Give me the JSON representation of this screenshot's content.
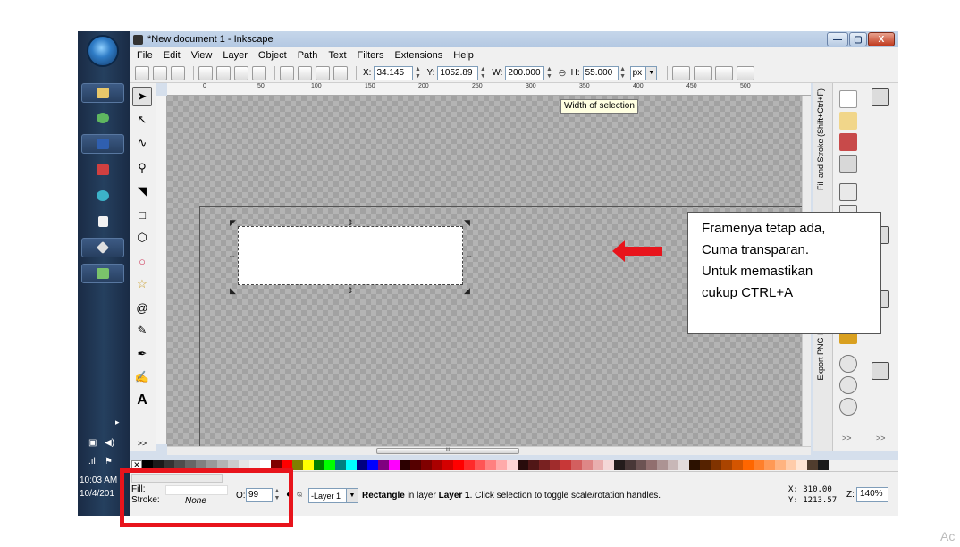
{
  "taskbar": {
    "clock_time": "10:03 AM",
    "clock_date": "10/4/201",
    "overflow": ">>",
    "colors": {
      "bar": "#1d2f4b",
      "accent": "#2f7cc6"
    }
  },
  "window": {
    "title": "*New document 1 - Inkscape",
    "controls": {
      "minimize": "—",
      "maximize": "▢",
      "close": "X"
    }
  },
  "menu": {
    "items": [
      "File",
      "Edit",
      "View",
      "Layer",
      "Object",
      "Path",
      "Text",
      "Filters",
      "Extensions",
      "Help"
    ]
  },
  "selection_toolbar": {
    "x_label": "X:",
    "x_value": "34.145",
    "y_label": "Y:",
    "y_value": "1052.89",
    "w_label": "W:",
    "w_value": "200.000",
    "h_label": "H:",
    "h_value": "55.000",
    "unit": "px",
    "tooltip": "Width of selection"
  },
  "ruler": {
    "labels": [
      "0",
      "50",
      "100",
      "150",
      "200",
      "250",
      "300",
      "350",
      "400",
      "450",
      "500"
    ]
  },
  "docks": {
    "fill_stroke_tab": "Fill and Stroke (Shift+Ctrl+F)",
    "export_tab": "Export PNG Image (Shift+Ctrl+E)",
    "overflow": ">>"
  },
  "callout": {
    "lines": [
      "Framenya tetap ada,",
      "Cuma transparan.",
      "Untuk memastikan",
      "cukup CTRL+A"
    ]
  },
  "palette": {
    "colors": [
      "#000000",
      "#1a1a1a",
      "#333333",
      "#4d4d4d",
      "#666666",
      "#808080",
      "#999999",
      "#b3b3b3",
      "#cccccc",
      "#e6e6e6",
      "#f2f2f2",
      "#ffffff",
      "#800000",
      "#ff0000",
      "#808000",
      "#ffff00",
      "#008000",
      "#00ff00",
      "#008080",
      "#00ffff",
      "#000080",
      "#0000ff",
      "#800080",
      "#ff00ff",
      "#2b0000",
      "#550000",
      "#800000",
      "#aa0000",
      "#d40000",
      "#ff0000",
      "#ff2a2a",
      "#ff5555",
      "#ff8080",
      "#ffaaaa",
      "#ffd5d5",
      "#280b0b",
      "#501616",
      "#782121",
      "#a02c2c",
      "#c83737",
      "#d35f5f",
      "#de8787",
      "#e9afaf",
      "#f4d7d7",
      "#241c1c",
      "#483737",
      "#6c5353",
      "#916f6f",
      "#ac9393",
      "#c8b7b7",
      "#e3dbdb",
      "#2b1100",
      "#552200",
      "#803300",
      "#aa4400",
      "#d45500",
      "#ff6600",
      "#ff7f2a",
      "#ff9955",
      "#ffb380",
      "#ffccaa",
      "#ffe6d5",
      "#503d2e",
      "#1a1a1a"
    ]
  },
  "status": {
    "fill_label": "Fill:",
    "stroke_label": "Stroke:",
    "stroke_value": "None",
    "opacity_label": "O:",
    "opacity_value": "99",
    "layer": "-Layer 1",
    "msg_object": "Rectangle",
    "msg_mid": " in layer ",
    "msg_layer": "Layer 1",
    "msg_tail": ". Click selection to toggle scale/rotation handles.",
    "coord_x": "X:  310.00",
    "coord_y": "Y: 1213.57",
    "zoom_label": "Z:",
    "zoom_value": "140%",
    "scroll_glyph": "III"
  },
  "corner_text": "Ac",
  "colors": {
    "annotation_red": "#e8141c",
    "selection_fill": "#ffffff"
  }
}
